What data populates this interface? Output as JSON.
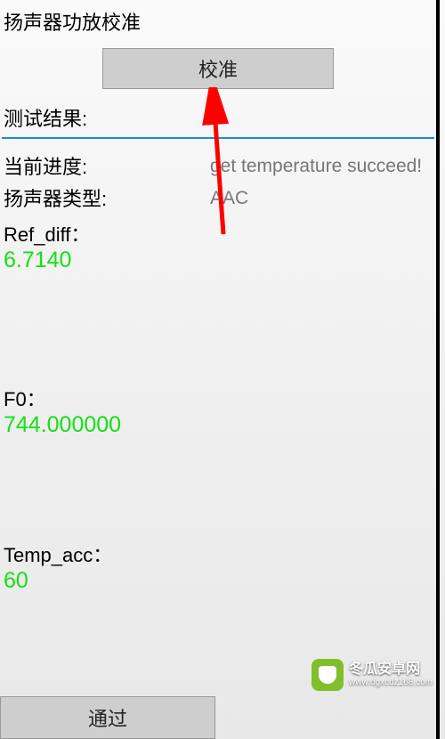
{
  "title": "扬声器功放校准",
  "calibrate_button": "校准",
  "result_label": "测试结果:",
  "progress": {
    "label": "当前进度:",
    "value": "get temperature succeed!"
  },
  "speaker_type": {
    "label": "扬声器类型:",
    "value": "AAC"
  },
  "ref_diff": {
    "label": "Ref_diff：",
    "value": "6.7140"
  },
  "f0": {
    "label": "F0：",
    "value": "744.000000"
  },
  "temp_acc": {
    "label": "Temp_acc：",
    "value": "60"
  },
  "pass_button": "通过",
  "watermark": {
    "line1": "冬瓜安卓网",
    "line2": "www.dgxcdz168.com"
  }
}
